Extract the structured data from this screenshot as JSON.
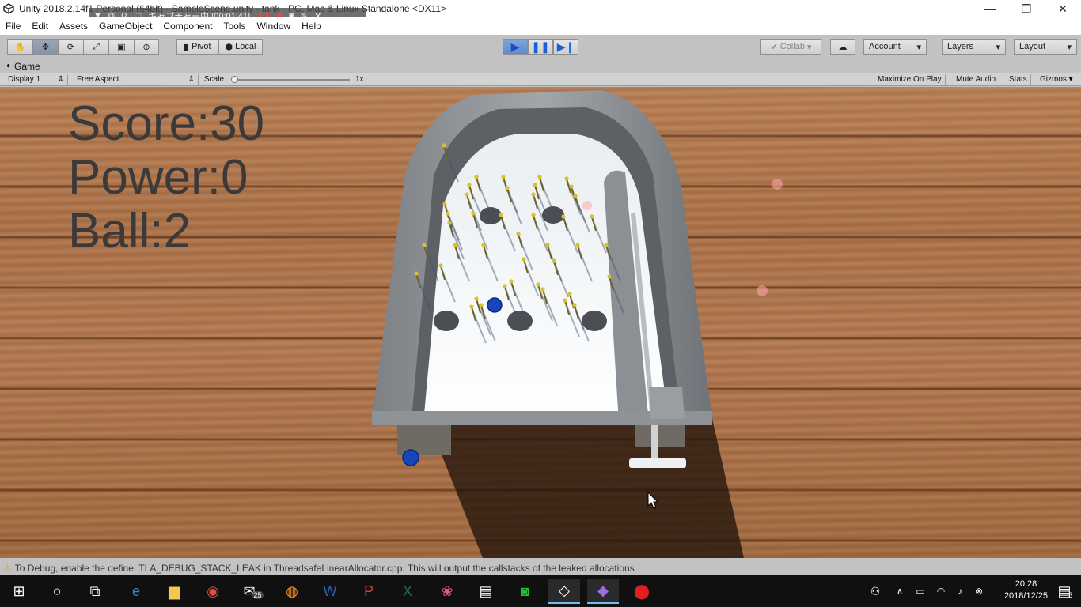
{
  "window": {
    "title": "Unity 2018.2.14f1 Personal (64bit) - SampleScene.unity - tank - PC, Mac & Linux Standalone <DX11>",
    "controls": [
      "—",
      "❐",
      "✕"
    ]
  },
  "capture": {
    "label": "キャプチャー中 [00:01:41]"
  },
  "menu": [
    "File",
    "Edit",
    "Assets",
    "GameObject",
    "Component",
    "Tools",
    "Window",
    "Help"
  ],
  "toolbar": {
    "pivot": "Pivot",
    "local": "Local",
    "collab": "Collab",
    "account": "Account",
    "layers": "Layers",
    "layout": "Layout"
  },
  "game_tab": {
    "label": "Game"
  },
  "gamebar": {
    "display": "Display 1",
    "aspect": "Free Aspect",
    "scale_label": "Scale",
    "scale_value": "1x",
    "maximize": "Maximize On Play",
    "mute": "Mute Audio",
    "stats": "Stats",
    "gizmos": "Gizmos"
  },
  "hud": {
    "score": "Score:30",
    "power": "Power:0",
    "ball": "Ball:2"
  },
  "status": {
    "message": "To Debug, enable the define: TLA_DEBUG_STACK_LEAK in ThreadsafeLinearAllocator.cpp. This will output the callstacks of the leaked allocations"
  },
  "taskbar": {
    "mail_badge": "25",
    "notification_count": "3",
    "time": "20:28",
    "date": "2018/12/25"
  },
  "colors": {
    "play_blue": "#1f5fd6",
    "board_white": "#f4f8fb",
    "frame_gray": "#8a8e93",
    "pin_yellow": "#d8c02a",
    "ball_blue": "#1746b8"
  }
}
